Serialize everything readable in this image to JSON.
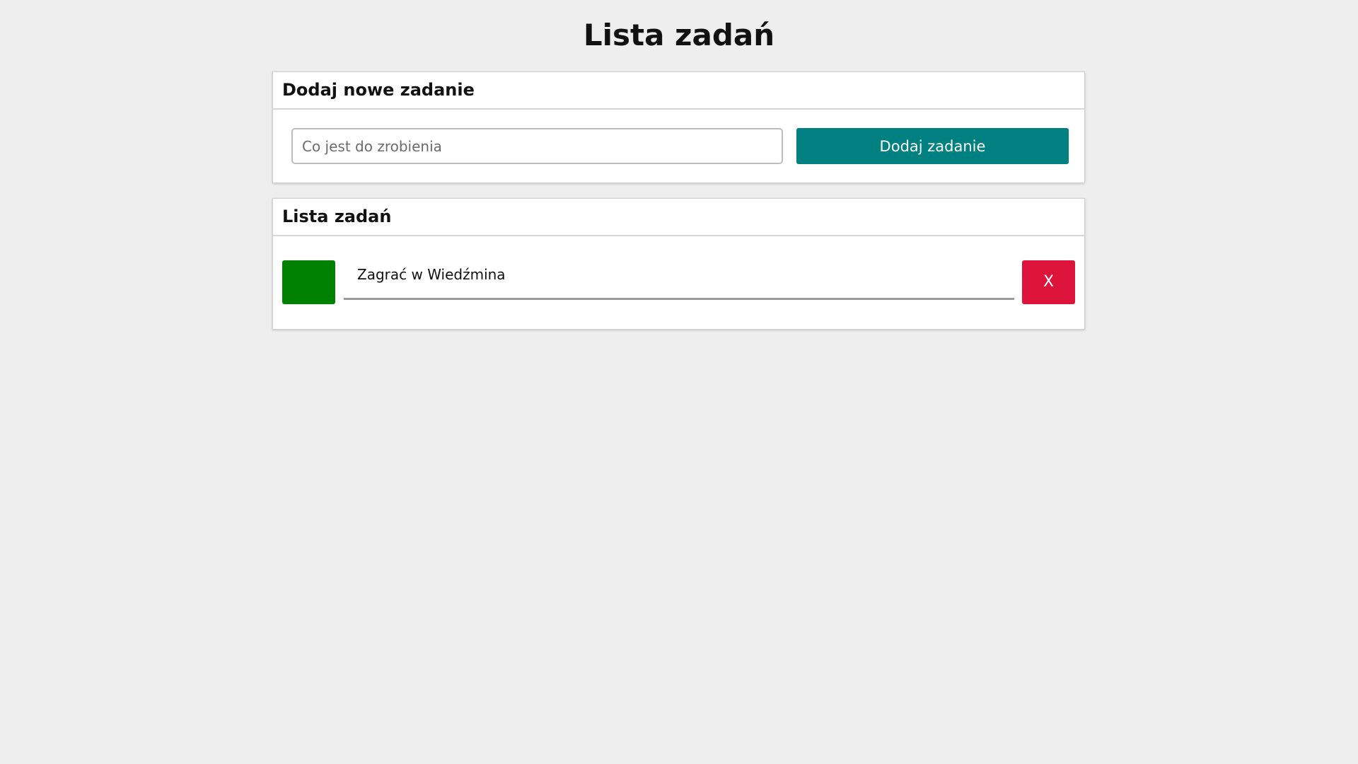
{
  "page": {
    "title": "Lista zadań"
  },
  "add_task": {
    "header": "Dodaj nowe zadanie",
    "input_placeholder": "Co jest do zrobienia",
    "input_value": "",
    "button_label": "Dodaj zadanie"
  },
  "task_list": {
    "header": "Lista zadań",
    "items": [
      {
        "text": "Zagrać w Wiedźmina",
        "delete_label": "X"
      }
    ]
  },
  "colors": {
    "background": "#eeeeee",
    "primary_button": "#008080",
    "done_button": "#008000",
    "delete_button": "#dc143c"
  }
}
